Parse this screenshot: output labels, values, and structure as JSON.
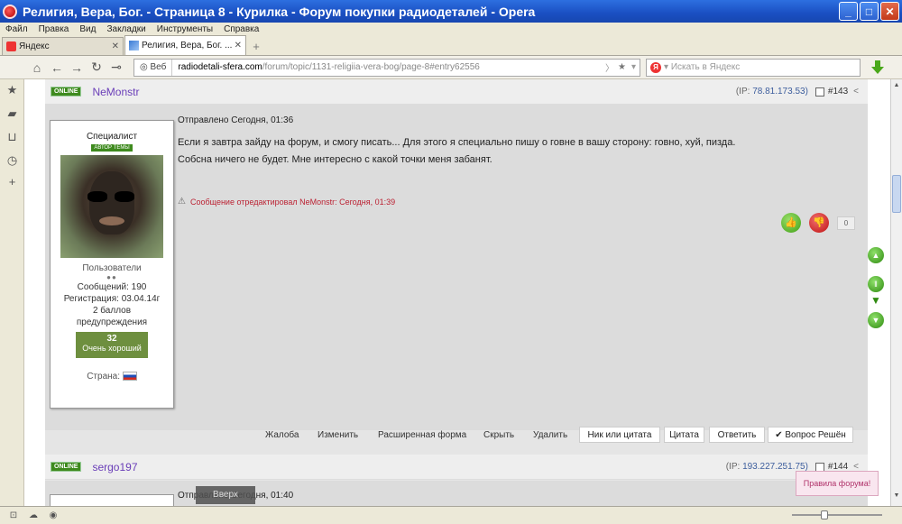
{
  "window": {
    "title": "Религия, Вера, Бог. - Страница 8 - Курилка - Форум покупки радиодеталей - Opera",
    "minimize_label": "_",
    "maximize_label": "□",
    "close_label": "✕"
  },
  "menu": [
    "Файл",
    "Правка",
    "Вид",
    "Закладки",
    "Инструменты",
    "Справка"
  ],
  "tabs": [
    {
      "label": "Яндекс",
      "close": "✕"
    },
    {
      "label": "Религия, Вера, Бог. ...",
      "close": "✕"
    }
  ],
  "new_tab_label": "+",
  "address": {
    "web_label": "Веб",
    "url_domain": "radiodetali-sfera.com",
    "url_path": "/forum/topic/1131-religiia-vera-bog/page-8#entry62556",
    "search_placeholder": "Искать в Яндекс"
  },
  "post": {
    "status": "ONLINE",
    "nick": "NeMonstr",
    "ip_prefix": "(IP:",
    "ip": "78.81.173.53)",
    "number": "#143",
    "date": "Отправлено Сегодня, 01:36",
    "line1": "Если я завтра зайду на форум, и смогу писать... Для этого я специально пишу о говне  в вашу сторону: говно, хуй, пизда.",
    "line2": "Собсна ничего не будет. Мне интересно с какой точки меня забанят.",
    "edited": "Сообщение отредактировал NeMonstr: Сегодня, 01:39",
    "vote_count": "0"
  },
  "user": {
    "role": "Специалист",
    "author_badge": "АВТОР ТЕМЫ",
    "group": "Пользователи",
    "dots": "●●",
    "messages": "Сообщений: 190",
    "registered": "Регистрация: 03.04.14г",
    "warnings_count": "2 баллов",
    "warnings_label": "предупреждения",
    "rep_value": "32",
    "rep_label": "Очень хороший",
    "country": "Страна:"
  },
  "actions": {
    "links": [
      "Жалоба",
      "Изменить",
      "Расширенная форма",
      "Скрыть",
      "Удалить"
    ],
    "buttons": [
      "Ник или цитата",
      "Цитата",
      "Ответить",
      "✔ Вопрос Решён"
    ]
  },
  "next_post": {
    "status": "ONLINE",
    "nick": "sergo197",
    "ip_prefix": "(IP:",
    "ip": "193.227.251.75)",
    "number": "#144",
    "date": "Отправлено Сегодня, 01:40",
    "top_button": "Вверх"
  },
  "rules_label": "Правила форума!",
  "zoom_fraction": 0.35
}
